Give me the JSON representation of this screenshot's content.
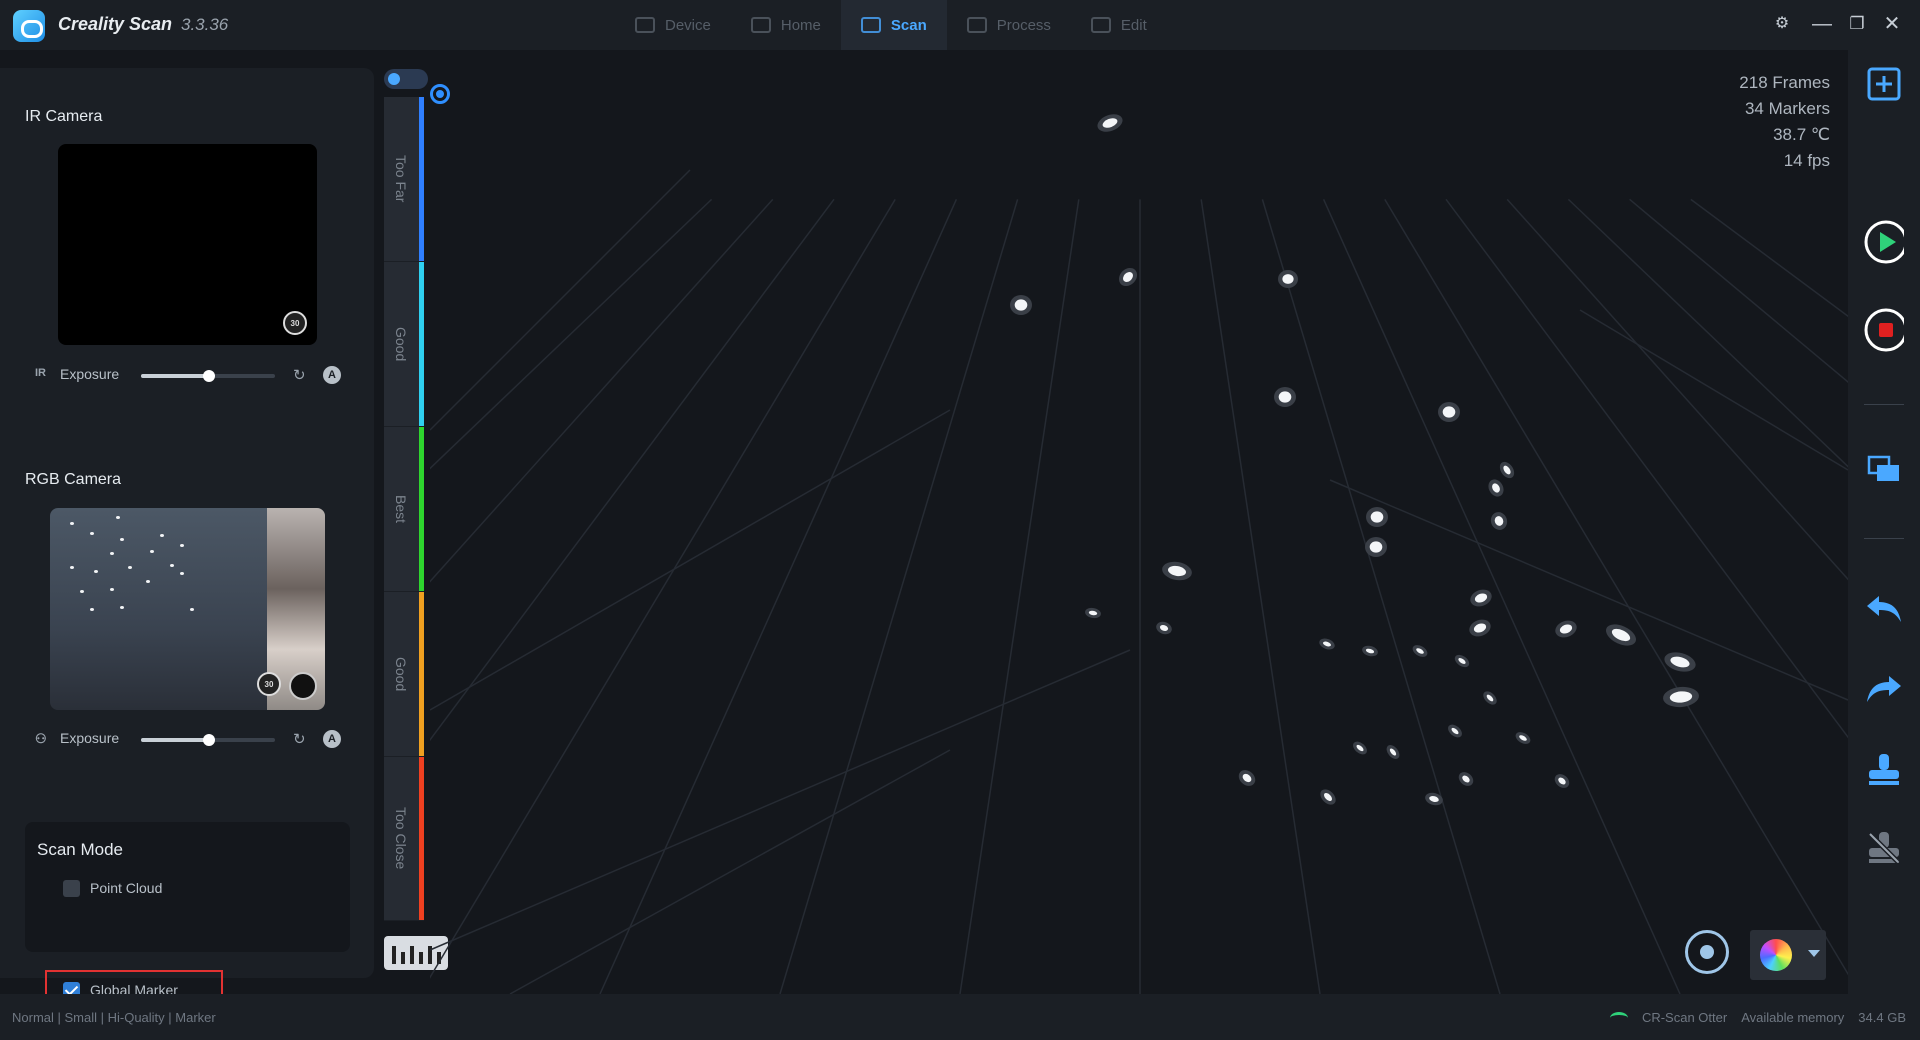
{
  "app": {
    "title": "Creality Scan",
    "version": "3.3.36"
  },
  "tabs": [
    {
      "label": "Device",
      "active": false
    },
    {
      "label": "Home",
      "active": false
    },
    {
      "label": "Scan",
      "active": true
    },
    {
      "label": "Process",
      "active": false
    },
    {
      "label": "Edit",
      "active": false
    }
  ],
  "left_panel": {
    "ir_camera": {
      "title": "IR Camera",
      "prefix": "IR",
      "exposure_label": "Exposure",
      "exposure_value": 0.51,
      "badge": "30"
    },
    "rgb_camera": {
      "title": "RGB Camera",
      "exposure_label": "Exposure",
      "exposure_value": 0.51,
      "badge": "30"
    },
    "scan_mode": {
      "title": "Scan Mode",
      "options": [
        {
          "label": "Point Cloud",
          "checked": false
        },
        {
          "label": "Global Marker",
          "checked": true
        }
      ]
    }
  },
  "distance_bar": {
    "segments": [
      {
        "label": "Too Far",
        "color": "#2f7fff"
      },
      {
        "label": "Good",
        "color": "#2fd0f0"
      },
      {
        "label": "Best",
        "color": "#2ed52e"
      },
      {
        "label": "Good",
        "color": "#f0a020"
      },
      {
        "label": "Too Close",
        "color": "#f04020"
      }
    ]
  },
  "stats": {
    "frames": "218 Frames",
    "markers": "34 Markers",
    "temperature": "38.7 ℃",
    "fps": "14 fps"
  },
  "status_bar": {
    "mode": "Normal | Small | Hi-Quality | Marker",
    "device": "CR-Scan Otter",
    "memory_label": "Available memory",
    "memory_value": "34.4 GB"
  },
  "colors": {
    "accent": "#2f8fff",
    "play": "#2fd27a",
    "stop": "#e02020",
    "highlight": "#e23232"
  }
}
